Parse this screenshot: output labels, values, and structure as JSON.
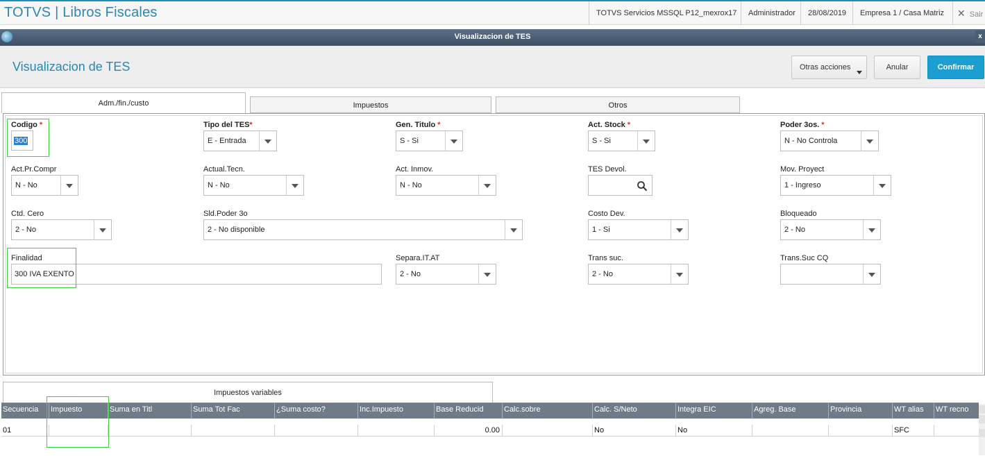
{
  "topbar": {
    "app_title": "TOTVS | Libros Fiscales",
    "server": "TOTVS Servicios MSSQL P12_mexrox17",
    "user": "Administrador",
    "date": "28/08/2019",
    "company": "Empresa 1 / Casa Matriz",
    "exit_label": "Sair"
  },
  "window": {
    "title": "Visualizacion de TES",
    "close": "x"
  },
  "header": {
    "title": "Visualizacion de TES",
    "other_actions": "Otras acciones",
    "cancel": "Anular",
    "confirm": "Confirmar"
  },
  "tabs": [
    "Adm./fin./custo",
    "Impuestos",
    "Otros"
  ],
  "fields": {
    "codigo": {
      "label": "Codigo",
      "required": "*",
      "value": "300"
    },
    "tipo_tes": {
      "label": "Tipo del TES",
      "required": "*",
      "value": "E - Entrada"
    },
    "gen_titulo": {
      "label": "Gen. Titulo",
      "required": "*",
      "value": "S - Si"
    },
    "act_stock": {
      "label": "Act. Stock",
      "required": "*",
      "value": "S - Si"
    },
    "poder_3os": {
      "label": "Poder 3os.",
      "required": "*",
      "value": "N - No Controla"
    },
    "act_pr_compr": {
      "label": "Act.Pr.Compr",
      "value": "N - No"
    },
    "actual_tecn": {
      "label": "Actual.Tecn.",
      "value": "N - No"
    },
    "act_inmov": {
      "label": "Act. Inmov.",
      "value": "N - No"
    },
    "tes_devol": {
      "label": "TES Devol.",
      "value": ""
    },
    "mov_proyect": {
      "label": "Mov. Proyect",
      "value": "1 - Ingreso"
    },
    "ctd_cero": {
      "label": "Ctd. Cero",
      "value": "2 - No"
    },
    "sld_poder_3o": {
      "label": "Sld.Poder 3o",
      "value": "2 - No disponible"
    },
    "costo_dev": {
      "label": "Costo Dev.",
      "value": "1 - Si"
    },
    "bloqueado": {
      "label": "Bloqueado",
      "value": "2 - No"
    },
    "finalidad": {
      "label": "Finalidad",
      "value": "300 IVA EXENTO"
    },
    "separa_it_at": {
      "label": "Separa.IT.AT",
      "value": "2 - No"
    },
    "trans_suc": {
      "label": "Trans suc.",
      "value": "2 - No"
    },
    "trans_suc_cq": {
      "label": "Trans.Suc CQ",
      "value": ""
    }
  },
  "grid": {
    "tab_label": "Impuestos variables",
    "columns": [
      "Secuencia",
      "Impuesto",
      "Suma en Titl",
      "Suma Tot Fac",
      "¿Suma costo?",
      "Inc.Impuesto",
      "Base Reducid",
      "Calc.sobre",
      "Calc. S/Neto",
      "Integra EIC",
      "Agreg. Base",
      "Provincia",
      "WT alias",
      "WT recno"
    ],
    "rows": [
      [
        "01",
        "",
        "",
        "",
        "",
        "",
        "0.00",
        "",
        "No",
        "No",
        "",
        "",
        "SFC",
        ""
      ]
    ]
  },
  "icons": {
    "app": "totvs-logo-icon",
    "search": "search-icon"
  }
}
